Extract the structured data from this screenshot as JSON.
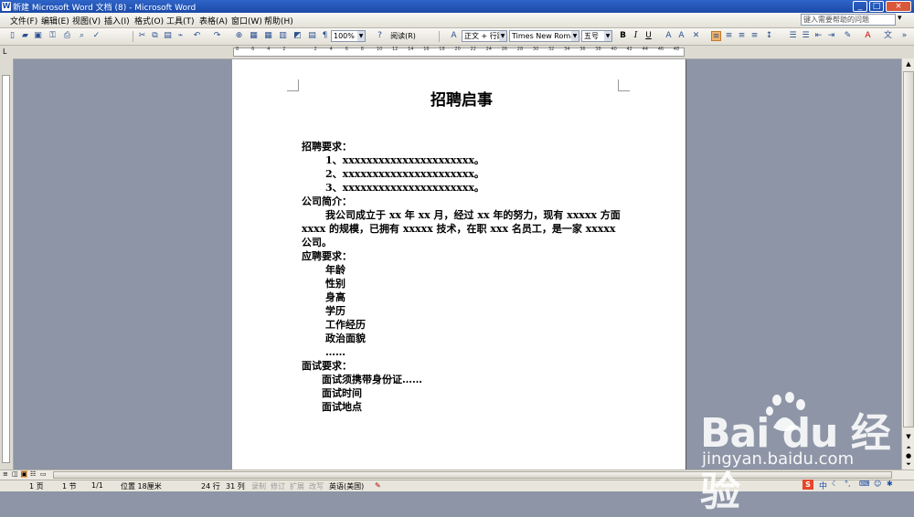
{
  "window": {
    "title": "新建 Microsoft Word 文档 (8) - Microsoft Word",
    "min": "_",
    "max": "□",
    "close": "×"
  },
  "menu": {
    "items": [
      "文件(F)",
      "编辑(E)",
      "视图(V)",
      "插入(I)",
      "格式(O)",
      "工具(T)",
      "表格(A)",
      "窗口(W)",
      "帮助(H)"
    ],
    "help_placeholder": "键入需要帮助的问题"
  },
  "toolbar": {
    "zoom": "100%",
    "read_label": "阅读(R)",
    "style": "正文 + 行距",
    "font": "Times New Roman",
    "size": "五号",
    "bold": "B",
    "italic": "I",
    "underline": "U"
  },
  "ruler": {
    "numbers": [
      "8",
      "6",
      "4",
      "2",
      "",
      "2",
      "4",
      "6",
      "8",
      "10",
      "12",
      "14",
      "16",
      "18",
      "20",
      "22",
      "24",
      "26",
      "28",
      "30",
      "32",
      "34",
      "36",
      "38",
      "40",
      "42",
      "44",
      "46",
      "48"
    ]
  },
  "document": {
    "title": "招聘启事",
    "lines": [
      {
        "text": "招聘要求：",
        "indent": 0
      },
      {
        "text": "1、xxxxxxxxxxxxxxxxxxxxxx。",
        "indent": 1
      },
      {
        "text": "2、xxxxxxxxxxxxxxxxxxxxxx。",
        "indent": 1
      },
      {
        "text": "3、xxxxxxxxxxxxxxxxxxxxxx。",
        "indent": 1
      },
      {
        "text": "公司简介：",
        "indent": 0
      },
      {
        "text": "我公司成立于 xx 年 xx 月，经过 xx 年的努力，现有 xxxxx 方面",
        "indent": 1
      },
      {
        "text": "xxxx 的规模，已拥有 xxxxx 技术，在职 xxx 名员工，是一家 xxxxx",
        "indent": 0
      },
      {
        "text": "公司。",
        "indent": 0
      },
      {
        "text": "应聘要求：",
        "indent": 0
      },
      {
        "text": "年龄",
        "indent": 1
      },
      {
        "text": "性别",
        "indent": 1
      },
      {
        "text": "身高",
        "indent": 1
      },
      {
        "text": "学历",
        "indent": 1
      },
      {
        "text": "工作经历",
        "indent": 1
      },
      {
        "text": "政治面貌",
        "indent": 1
      },
      {
        "text": "……",
        "indent": 1
      },
      {
        "text": "面试要求：",
        "indent": 0
      },
      {
        "text": "面试须携带身份证……",
        "indent": 2
      },
      {
        "text": "面试时间",
        "indent": 2
      },
      {
        "text": "面试地点",
        "indent": 2
      }
    ]
  },
  "status": {
    "page": "1 页",
    "section": "1 节",
    "pages": "1/1",
    "position": "位置 18厘米",
    "line": "24 行",
    "column": "31 列",
    "rec": "录制",
    "trk": "修订",
    "ext": "扩展",
    "ovr": "改写",
    "language": "英语(美国)"
  },
  "watermark": {
    "logo": "Bai du 经验",
    "url": "jingyan.baidu.com"
  },
  "ime": {
    "label": "中"
  }
}
